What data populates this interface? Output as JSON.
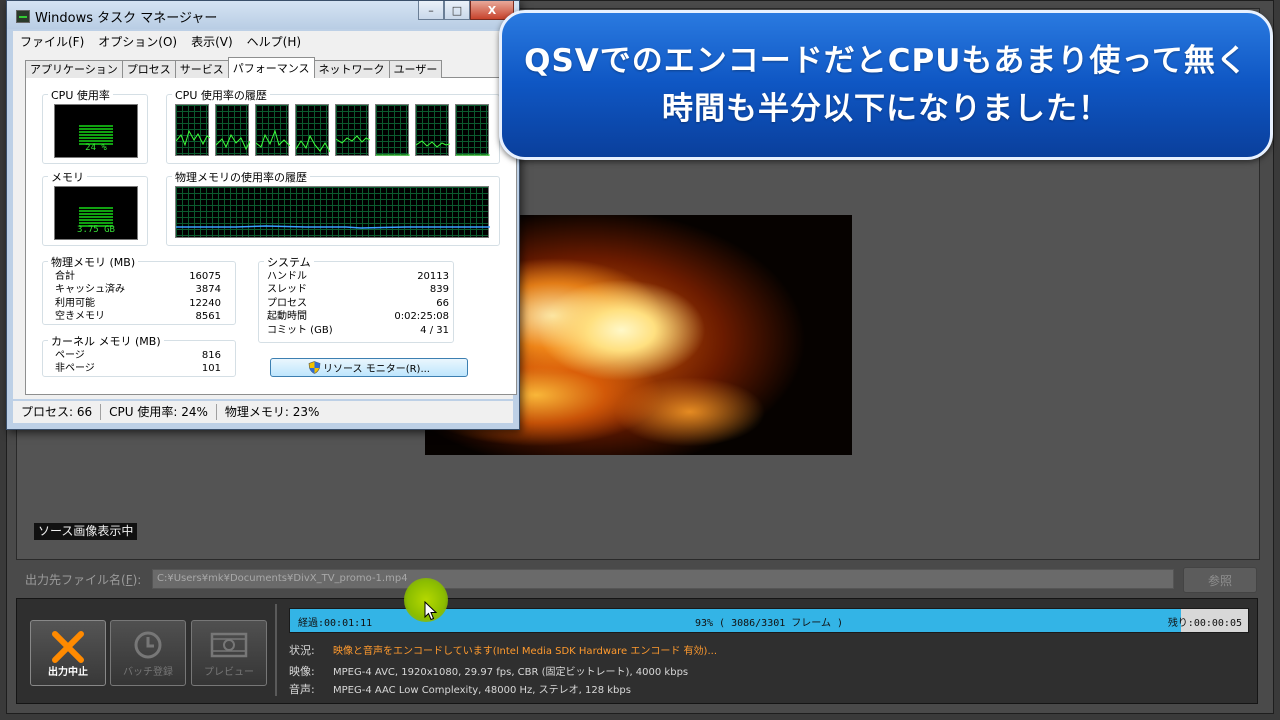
{
  "task_manager": {
    "title": "Windows タスク マネージャー",
    "window_buttons": [
      "–",
      "□",
      "X"
    ],
    "menu": [
      "ファイル(F)",
      "オプション(O)",
      "表示(V)",
      "ヘルプ(H)"
    ],
    "tabs": [
      "アプリケーション",
      "プロセス",
      "サービス",
      "パフォーマンス",
      "ネットワーク",
      "ユーザー"
    ],
    "active_tab": "パフォーマンス",
    "cpu": {
      "label": "CPU 使用率",
      "value_text": "24 %",
      "level": 0.24
    },
    "cpu_history_label": "CPU 使用率の履歴",
    "memory": {
      "label": "メモリ",
      "value_text": "3.75 GB",
      "level": 0.23
    },
    "memory_history_label": "物理メモリの使用率の履歴",
    "physical_memory": {
      "title": "物理メモリ (MB)",
      "rows": [
        {
          "label": "合計",
          "value": "16075"
        },
        {
          "label": "キャッシュ済み",
          "value": "3874"
        },
        {
          "label": "利用可能",
          "value": "12240"
        },
        {
          "label": "空きメモリ",
          "value": "8561"
        }
      ]
    },
    "kernel_memory": {
      "title": "カーネル メモリ (MB)",
      "rows": [
        {
          "label": "ページ",
          "value": "816"
        },
        {
          "label": "非ページ",
          "value": "101"
        }
      ]
    },
    "system": {
      "title": "システム",
      "rows": [
        {
          "label": "ハンドル",
          "value": "20113"
        },
        {
          "label": "スレッド",
          "value": "839"
        },
        {
          "label": "プロセス",
          "value": "66"
        },
        {
          "label": "起動時間",
          "value": "0:02:25:08"
        },
        {
          "label": "コミット (GB)",
          "value": "4 / 31"
        }
      ]
    },
    "resource_monitor_button": "リソース モニター(R)...",
    "statusbar": {
      "processes": "プロセス: 66",
      "cpu": "CPU 使用率: 24%",
      "memory": "物理メモリ: 23%"
    }
  },
  "caption": {
    "line1": "QSVでのエンコードだとCPUもあまり使って無く",
    "line2": "時間も半分以下になりました！"
  },
  "encoder": {
    "source_tag": "ソース画像表示中",
    "output_label": "出力先ファイル名(",
    "output_label_key": "F",
    "output_label_end": "):",
    "output_path": "C:¥Users¥mk¥Documents¥DivX_TV_promo-1.mp4",
    "browse_button": "参照",
    "buttons": {
      "stop": "出力中止",
      "batch": "バッチ登録",
      "preview": "プレビュー"
    },
    "progress": {
      "elapsed": "経過:00:01:11",
      "center": "93% ( 3086/3301 フレーム )",
      "remaining": "残り:00:00:05",
      "fraction": 0.93
    },
    "info": {
      "status_label": "状況:",
      "status_value": "映像と音声をエンコードしています(Intel Media SDK Hardware エンコード 有効)...",
      "video_label": "映像:",
      "video_value": "MPEG-4 AVC, 1920x1080, 29.97 fps, CBR (固定ビットレート), 4000 kbps",
      "audio_label": "音声:",
      "audio_value": "MPEG-4 AAC Low Complexity, 48000 Hz, ステレオ, 128 kbps"
    }
  },
  "colors": {
    "progress_fill": "#33b4e6",
    "status_orange": "#ff9a2e",
    "caption_blue": "#0f57c4",
    "meter_green": "#11a211",
    "stop_icon": "#ff8a00"
  },
  "icons": [
    "close-x-icon",
    "clock-icon",
    "film-preview-icon",
    "shield-icon",
    "mouse-cursor-icon"
  ]
}
